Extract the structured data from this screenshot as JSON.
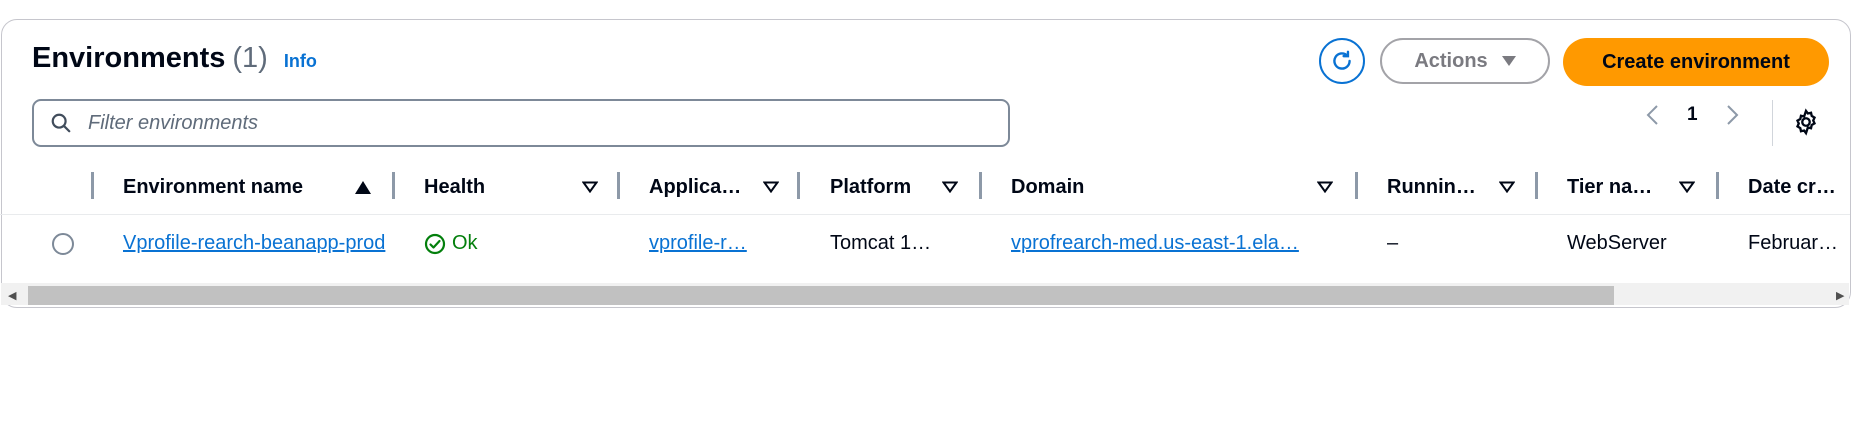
{
  "header": {
    "title": "Environments",
    "count": "(1)",
    "info_link": "Info"
  },
  "toolbar": {
    "actions_label": "Actions",
    "create_label": "Create environment"
  },
  "filter": {
    "placeholder": "Filter environments"
  },
  "pagination": {
    "current_page": "1"
  },
  "table": {
    "columns": [
      "Environment name",
      "Health",
      "Applica…",
      "Platform",
      "Domain",
      "Runnin…",
      "Tier na…",
      "Date cr…"
    ],
    "rows": [
      {
        "environment_name": "Vprofile-rearch-beanapp-prod",
        "health": "Ok",
        "application": "vprofile-r…",
        "platform": "Tomcat 1…",
        "domain": "vprofrearch-med.us-east-1.ela…",
        "running_version": "–",
        "tier_name": "WebServer",
        "date_created": "February …"
      }
    ]
  },
  "colors": {
    "accent": "#0972d3",
    "primary_button": "#ff9900",
    "status_ok": "#037f0c"
  }
}
